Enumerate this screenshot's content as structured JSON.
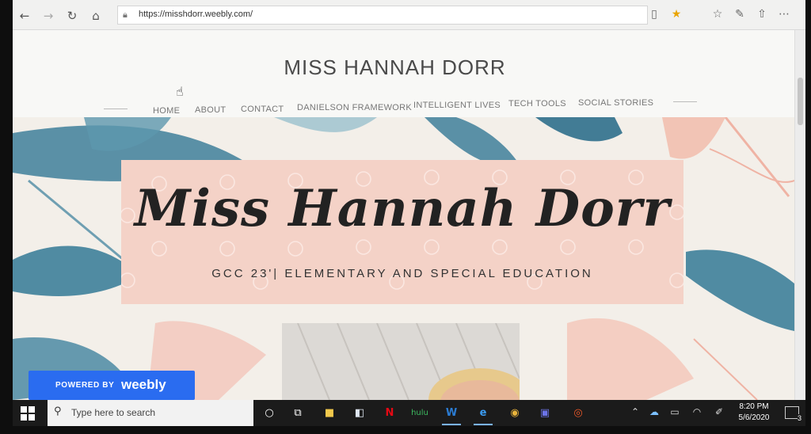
{
  "browser": {
    "url": "https://misshdorr.weebly.com/"
  },
  "site": {
    "title": "MISS HANNAH DORR",
    "nav": [
      "HOME",
      "ABOUT",
      "CONTACT",
      "DANIELSON FRAMEWORK",
      "INTELLIGENT LIVES",
      "TECH TOOLS",
      "SOCIAL STORIES"
    ]
  },
  "hero": {
    "script_title": "Miss Hannah Dorr",
    "subtitle": "GCC 23'| ELEMENTARY AND SPECIAL EDUCATION"
  },
  "badge": {
    "powered_by": "POWERED BY",
    "brand": "weebly"
  },
  "taskbar": {
    "search_placeholder": "Type here to search",
    "time": "8:20 PM",
    "date": "5/6/2020",
    "notification_count": "3"
  },
  "colors": {
    "panel": "#f4d2c7",
    "leaf": "#3e7f9a",
    "weebly_blue": "#2a6cf0"
  }
}
